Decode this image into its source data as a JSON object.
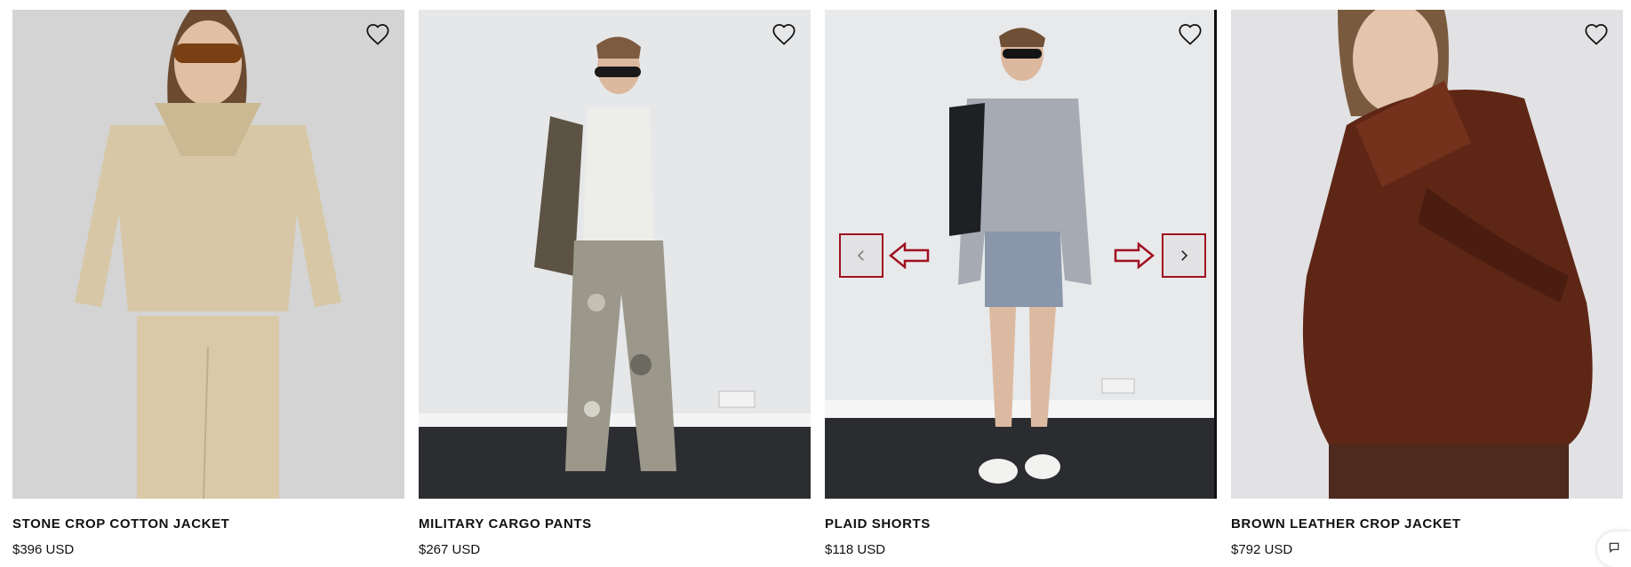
{
  "products": [
    {
      "name": "STONE CROP COTTON JACKET",
      "price": "$396 USD",
      "wishlist_icon": "heart-outline-icon"
    },
    {
      "name": "MILITARY CARGO PANTS",
      "price": "$267 USD",
      "wishlist_icon": "heart-outline-icon"
    },
    {
      "name": "PLAID SHORTS",
      "price": "$118 USD",
      "wishlist_icon": "heart-outline-icon",
      "carousel": {
        "prev_icon": "chevron-left-icon",
        "next_icon": "chevron-right-icon",
        "highlight_color": "#a01020"
      }
    },
    {
      "name": "BROWN LEATHER CROP JACKET",
      "price": "$792 USD",
      "wishlist_icon": "heart-outline-icon"
    }
  ],
  "chat": {
    "icon": "chat-bubble-icon"
  }
}
